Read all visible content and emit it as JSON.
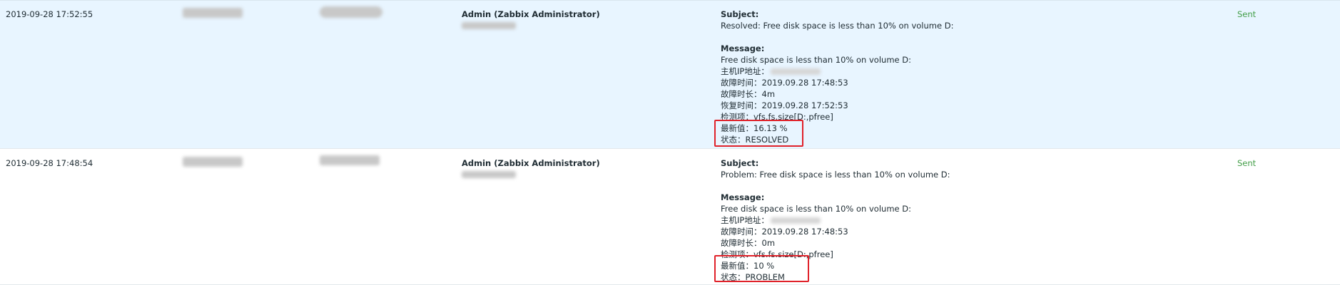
{
  "rows": [
    {
      "time": "2019-09-28 17:52:55",
      "user": "Admin (Zabbix Administrator)",
      "subject_label": "Subject:",
      "subject": "Resolved: Free disk space is less than 10% on volume D:",
      "message_label": "Message:",
      "lines": [
        "Free disk space is less than 10% on volume D:",
        "主机IP地址：",
        "故障时间：2019.09.28 17:48:53",
        "故障时长：4m",
        "恢复时间：2019.09.28 17:52:53",
        "检测项：vfs.fs.size[D:,pfree]",
        "最新值：16.13 %",
        "状态：RESOLVED"
      ],
      "status": "Sent"
    },
    {
      "time": "2019-09-28 17:48:54",
      "user": "Admin (Zabbix Administrator)",
      "subject_label": "Subject:",
      "subject": "Problem: Free disk space is less than 10% on volume D:",
      "message_label": "Message:",
      "lines": [
        "Free disk space is less than 10% on volume D:",
        "主机IP地址：",
        "故障时间：2019.09.28 17:48:53",
        "故障时长：0m",
        "检测项：vfs.fs.size[D:,pfree]",
        "最新值：10 %",
        "状态：PROBLEM"
      ],
      "status": "Sent"
    }
  ],
  "colors": {
    "highlight_row": "#e8f5ff",
    "status_sent": "#429e47",
    "annotation_box": "#e0222a"
  }
}
